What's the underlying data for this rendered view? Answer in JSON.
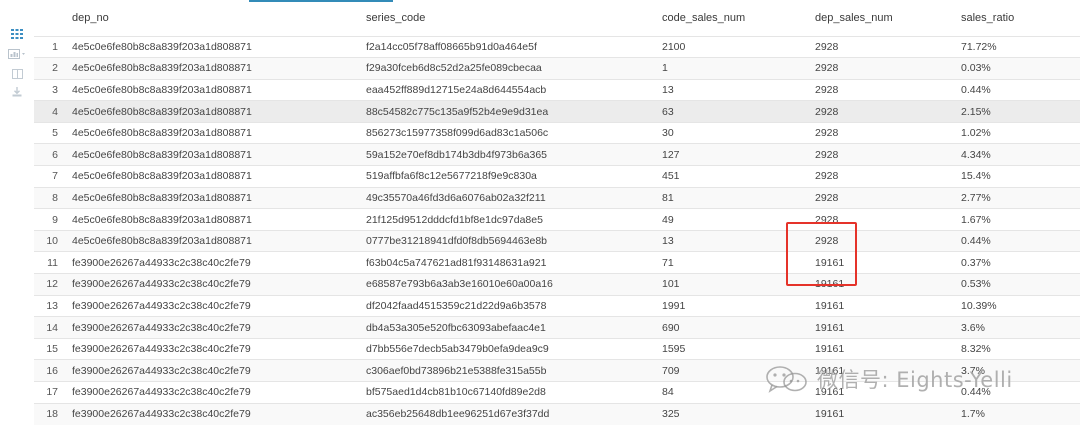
{
  "toolbar": {
    "icons": [
      "grid-view-icon",
      "chart-view-icon",
      "panel-icon",
      "download-icon"
    ],
    "accent_color": "#338bb8"
  },
  "table": {
    "columns": [
      "dep_no",
      "series_code",
      "code_sales_num",
      "dep_sales_num",
      "sales_ratio"
    ],
    "rows": [
      {
        "index": "1",
        "dep_no": "4e5c0e6fe80b8c8a839f203a1d808871",
        "series_code": "f2a14cc05f78aff08665b91d0a464e5f",
        "code_sales_num": "2100",
        "dep_sales_num": "2928",
        "sales_ratio": "71.72%"
      },
      {
        "index": "2",
        "dep_no": "4e5c0e6fe80b8c8a839f203a1d808871",
        "series_code": "f29a30fceb6d8c52d2a25fe089cbecaa",
        "code_sales_num": "1",
        "dep_sales_num": "2928",
        "sales_ratio": "0.03%"
      },
      {
        "index": "3",
        "dep_no": "4e5c0e6fe80b8c8a839f203a1d808871",
        "series_code": "eaa452ff889d12715e24a8d644554acb",
        "code_sales_num": "13",
        "dep_sales_num": "2928",
        "sales_ratio": "0.44%"
      },
      {
        "index": "4",
        "dep_no": "4e5c0e6fe80b8c8a839f203a1d808871",
        "series_code": "88c54582c775c135a9f52b4e9e9d31ea",
        "code_sales_num": "63",
        "dep_sales_num": "2928",
        "sales_ratio": "2.15%"
      },
      {
        "index": "5",
        "dep_no": "4e5c0e6fe80b8c8a839f203a1d808871",
        "series_code": "856273c15977358f099d6ad83c1a506c",
        "code_sales_num": "30",
        "dep_sales_num": "2928",
        "sales_ratio": "1.02%"
      },
      {
        "index": "6",
        "dep_no": "4e5c0e6fe80b8c8a839f203a1d808871",
        "series_code": "59a152e70ef8db174b3db4f973b6a365",
        "code_sales_num": "127",
        "dep_sales_num": "2928",
        "sales_ratio": "4.34%"
      },
      {
        "index": "7",
        "dep_no": "4e5c0e6fe80b8c8a839f203a1d808871",
        "series_code": "519affbfa6f8c12e5677218f9e9c830a",
        "code_sales_num": "451",
        "dep_sales_num": "2928",
        "sales_ratio": "15.4%"
      },
      {
        "index": "8",
        "dep_no": "4e5c0e6fe80b8c8a839f203a1d808871",
        "series_code": "49c35570a46fd3d6a6076ab02a32f211",
        "code_sales_num": "81",
        "dep_sales_num": "2928",
        "sales_ratio": "2.77%"
      },
      {
        "index": "9",
        "dep_no": "4e5c0e6fe80b8c8a839f203a1d808871",
        "series_code": "21f125d9512dddcfd1bf8e1dc97da8e5",
        "code_sales_num": "49",
        "dep_sales_num": "2928",
        "sales_ratio": "1.67%"
      },
      {
        "index": "10",
        "dep_no": "4e5c0e6fe80b8c8a839f203a1d808871",
        "series_code": "0777be31218941dfd0f8db5694463e8b",
        "code_sales_num": "13",
        "dep_sales_num": "2928",
        "sales_ratio": "0.44%"
      },
      {
        "index": "11",
        "dep_no": "fe3900e26267a44933c2c38c40c2fe79",
        "series_code": "f63b04c5a747621ad81f93148631a921",
        "code_sales_num": "71",
        "dep_sales_num": "19161",
        "sales_ratio": "0.37%"
      },
      {
        "index": "12",
        "dep_no": "fe3900e26267a44933c2c38c40c2fe79",
        "series_code": "e68587e793b6a3ab3e16010e60a00a16",
        "code_sales_num": "101",
        "dep_sales_num": "19161",
        "sales_ratio": "0.53%"
      },
      {
        "index": "13",
        "dep_no": "fe3900e26267a44933c2c38c40c2fe79",
        "series_code": "df2042faad4515359c21d22d9a6b3578",
        "code_sales_num": "1991",
        "dep_sales_num": "19161",
        "sales_ratio": "10.39%"
      },
      {
        "index": "14",
        "dep_no": "fe3900e26267a44933c2c38c40c2fe79",
        "series_code": "db4a53a305e520fbc63093abefaac4e1",
        "code_sales_num": "690",
        "dep_sales_num": "19161",
        "sales_ratio": "3.6%"
      },
      {
        "index": "15",
        "dep_no": "fe3900e26267a44933c2c38c40c2fe79",
        "series_code": "d7bb556e7decb5ab3479b0efa9dea9c9",
        "code_sales_num": "1595",
        "dep_sales_num": "19161",
        "sales_ratio": "8.32%"
      },
      {
        "index": "16",
        "dep_no": "fe3900e26267a44933c2c38c40c2fe79",
        "series_code": "c306aef0bd73896b21e5388fe315a55b",
        "code_sales_num": "709",
        "dep_sales_num": "19161",
        "sales_ratio": "3.7%"
      },
      {
        "index": "17",
        "dep_no": "fe3900e26267a44933c2c38c40c2fe79",
        "series_code": "bf575aed1d4cb81b10c67140fd89e2d8",
        "code_sales_num": "84",
        "dep_sales_num": "19161",
        "sales_ratio": "0.44%"
      },
      {
        "index": "18",
        "dep_no": "fe3900e26267a44933c2c38c40c2fe79",
        "series_code": "ac356eb25648db1ee96251d67e3f37dd",
        "code_sales_num": "325",
        "dep_sales_num": "19161",
        "sales_ratio": "1.7%"
      }
    ],
    "hover_row_index": 4
  },
  "annotation": {
    "highlight_color": "#e5332a"
  },
  "watermark": {
    "text": "微信号: Eights-Yelli"
  }
}
